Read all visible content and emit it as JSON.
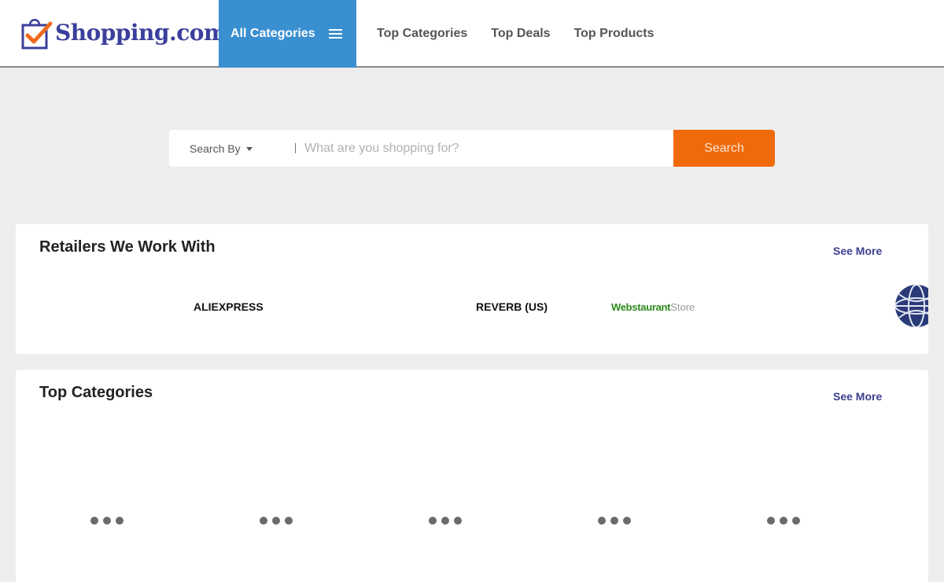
{
  "header": {
    "logo_text": "Shopping.com",
    "logo_reg": "®",
    "all_categories_label": "All Categories",
    "nav": [
      "Top Categories",
      "Top Deals",
      "Top Products"
    ]
  },
  "search": {
    "search_by_label": "Search By",
    "placeholder": "What are you shopping for?",
    "button_label": "Search"
  },
  "retailers": {
    "title": "Retailers We Work With",
    "see_more": "See More",
    "items": [
      "ALIEXPRESS",
      "REVERB (US)"
    ],
    "webstaurant": {
      "part1": "Webstaurant",
      "part2": "Store"
    }
  },
  "top_categories": {
    "title": "Top Categories",
    "see_more": "See More",
    "loading_count": 5
  },
  "colors": {
    "brand_blue": "#3b3f9c",
    "accent_blue": "#3a8fd0",
    "search_orange": "#f06a0b",
    "background": "#ededed"
  },
  "icons": [
    "shopping-bag-check-icon",
    "hamburger-menu-icon",
    "caret-down-icon",
    "globe-logo-icon",
    "loading-dots-icon"
  ]
}
